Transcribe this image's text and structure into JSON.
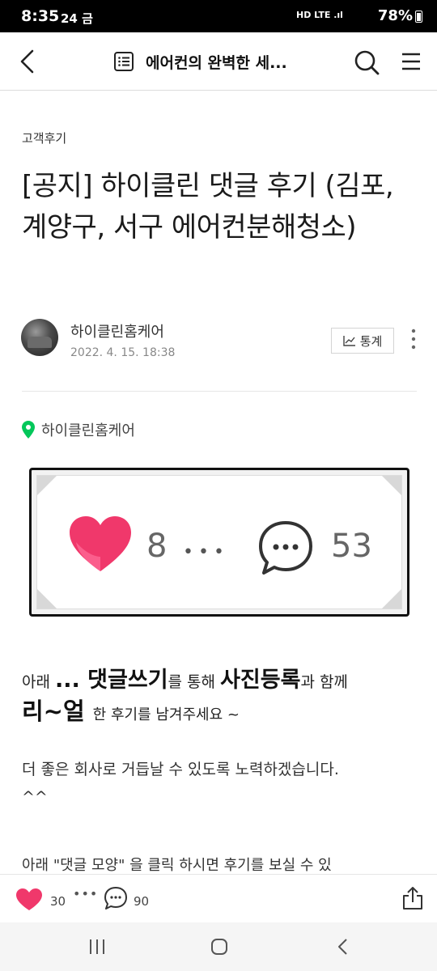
{
  "status_bar": {
    "time": "8:35",
    "date": "24 금",
    "indicators": "HD LTE .ıl",
    "battery": "78%",
    "battery_level": 0.78
  },
  "nav": {
    "title": "에어컨의 완벽한 세..."
  },
  "post": {
    "category": "고객후기",
    "title": "[공지] 하이클린 댓글 후기 (김포, 계양구, 서구 에어컨분해청소)",
    "author": "하이클린홈케어",
    "date": "2022. 4. 15. 18:38",
    "stats_label": "통계",
    "location": "하이클린홈케어"
  },
  "image_card": {
    "likes": "8",
    "dots": "•••",
    "comments": "53"
  },
  "body": {
    "line1_a": "아래 ",
    "line1_b": "... 댓글쓰기",
    "line1_c": "를 통해 ",
    "line1_d": "사진등록",
    "line1_e": "과 함께",
    "line2_a": "리~얼",
    "line2_b": "한 후기를 남겨주세요 ~",
    "line3": "더 좋은 회사로 거듭날 수 있도록 노력하겠습니다.",
    "line4": "^^",
    "line5": "아래 \"댓글 모양\" 을 클릭 하시면 후기를 보실 수 있"
  },
  "action_bar": {
    "likes": "30",
    "dots": "•••",
    "comments": "90"
  },
  "colors": {
    "heart": "#f0386b",
    "pin": "#03c75a",
    "status_bg": "#000000"
  },
  "icons": [
    "back-icon",
    "list-icon",
    "search-icon",
    "menu-icon",
    "stats-icon",
    "more-icon",
    "pin-icon",
    "heart-icon",
    "comment-icon",
    "share-icon"
  ]
}
